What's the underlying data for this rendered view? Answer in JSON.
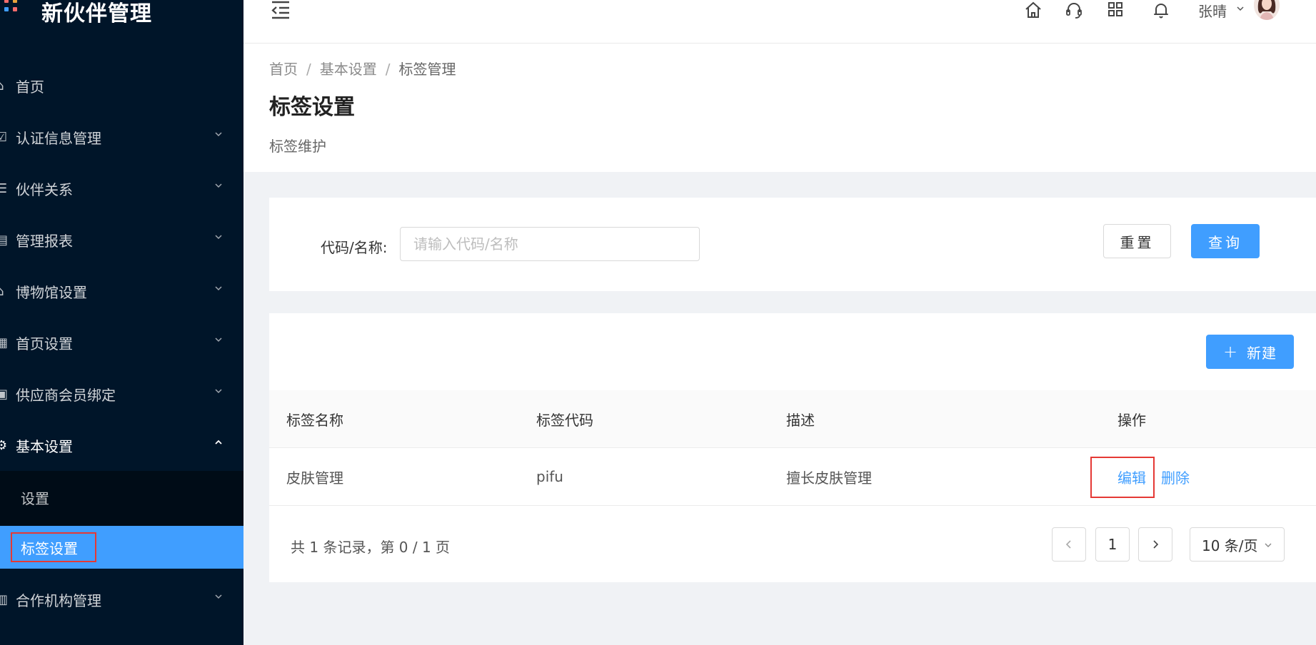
{
  "app": {
    "title": "新伙伴管理"
  },
  "colors": {
    "sidebar_bg": "#001529",
    "accent": "#409eff",
    "highlight_box": "#e53935"
  },
  "sidebar": {
    "items": [
      {
        "label": "首页",
        "icon": "home-icon"
      },
      {
        "label": "认证信息管理",
        "icon": "certificate-icon"
      },
      {
        "label": "伙伴关系",
        "icon": "list-icon"
      },
      {
        "label": "管理报表",
        "icon": "report-icon"
      },
      {
        "label": "博物馆设置",
        "icon": "museum-icon"
      },
      {
        "label": "首页设置",
        "icon": "layout-icon"
      },
      {
        "label": "供应商会员绑定",
        "icon": "link-icon"
      },
      {
        "label": "基本设置",
        "icon": "gear-icon",
        "expanded": true
      },
      {
        "label": "合作机构管理",
        "icon": "building-icon"
      }
    ],
    "submenu": [
      {
        "label": "设置"
      },
      {
        "label": "标签设置",
        "active": true
      }
    ]
  },
  "header": {
    "icons": [
      "home-icon",
      "headset-icon",
      "grid-icon",
      "bell-icon"
    ],
    "username": "张晴"
  },
  "breadcrumb": [
    "首页",
    "基本设置",
    "标签管理"
  ],
  "page": {
    "title": "标签设置",
    "description": "标签维护"
  },
  "search": {
    "label": "代码/名称:",
    "placeholder": "请输入代码/名称",
    "value": "",
    "reset_label": "重置",
    "query_label": "查询"
  },
  "table": {
    "new_label": "新建",
    "columns": [
      "标签名称",
      "标签代码",
      "描述",
      "操作"
    ],
    "rows": [
      {
        "name": "皮肤管理",
        "code": "pifu",
        "desc": "擅长皮肤管理",
        "edit": "编辑",
        "delete": "删除"
      }
    ]
  },
  "pagination": {
    "summary": "共 1 条记录，第 0 / 1 页",
    "current_page": "1",
    "page_size": "10 条/页"
  }
}
